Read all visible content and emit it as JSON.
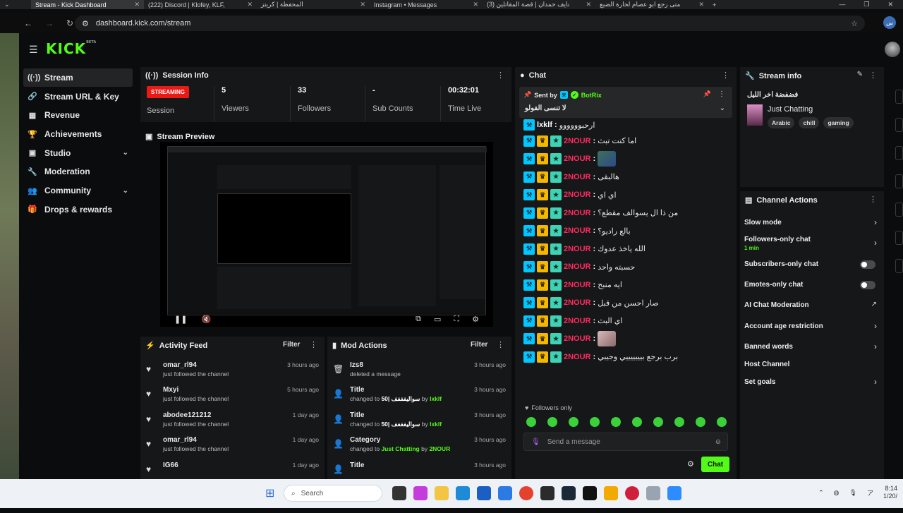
{
  "browser": {
    "tabs": [
      {
        "label": "Stream - Kick Dashboard",
        "active": true
      },
      {
        "label": "(222) Discord | Klofey, KLF,"
      },
      {
        "label": "المحفظة | كريتز"
      },
      {
        "label": "Instagram • Messages"
      },
      {
        "label": "(3) نايف حمدان | قصة المقاتلين"
      },
      {
        "label": "متى رجع ابو عصام لحارة الضبع"
      }
    ],
    "url": "dashboard.kick.com/stream",
    "profile_initial": "س"
  },
  "app": {
    "logo": "KICK",
    "logo_beta": "BETA"
  },
  "sidebar": {
    "items": [
      {
        "label": "Stream",
        "icon": "broadcast-icon",
        "glyph": "((·))",
        "active": true
      },
      {
        "label": "Stream URL & Key",
        "icon": "link-icon",
        "glyph": "🔗"
      },
      {
        "label": "Revenue",
        "icon": "revenue-icon",
        "glyph": "▦"
      },
      {
        "label": "Achievements",
        "icon": "trophy-icon",
        "glyph": "🏆"
      },
      {
        "label": "Studio",
        "icon": "studio-icon",
        "glyph": "▣",
        "expand": "⌄"
      },
      {
        "label": "Moderation",
        "icon": "wrench-icon",
        "glyph": "🔧"
      },
      {
        "label": "Community",
        "icon": "community-icon",
        "glyph": "👥",
        "expand": "⌄"
      },
      {
        "label": "Drops & rewards",
        "icon": "drops-icon",
        "glyph": "🎁"
      }
    ]
  },
  "session": {
    "title": "Session Info",
    "status": "STREAMING",
    "status_label": "Session",
    "stats": [
      {
        "value": "5",
        "label": "Viewers"
      },
      {
        "value": "33",
        "label": "Followers"
      },
      {
        "value": "-",
        "label": "Sub Counts"
      },
      {
        "value": "00:32:01",
        "label": "Time Live"
      }
    ]
  },
  "preview": {
    "title": "Stream Preview"
  },
  "activity": {
    "title": "Activity Feed",
    "filter": "Filter",
    "items": [
      {
        "name": "omar_rl94",
        "sub": "just followed the channel",
        "time": "3 hours ago"
      },
      {
        "name": "Mxyi",
        "sub": "just followed the channel",
        "time": "5 hours ago"
      },
      {
        "name": "abodee121212",
        "sub": "just followed the channel",
        "time": "1 day ago"
      },
      {
        "name": "omar_rl94",
        "sub": "just followed the channel",
        "time": "1 day ago"
      },
      {
        "name": "IG66",
        "sub": "",
        "time": "1 day ago"
      }
    ]
  },
  "mod_actions": {
    "title": "Mod Actions",
    "filter": "Filter",
    "items": [
      {
        "name": "Izs8",
        "pre": "deleted a message",
        "val": "",
        "by": "",
        "user": "",
        "time": "3 hours ago"
      },
      {
        "name": "Title",
        "pre": "changed to ",
        "val": "50| سواليفففف",
        "by": " by ",
        "user": "lxklf",
        "time": "3 hours ago"
      },
      {
        "name": "Title",
        "pre": "changed to ",
        "val": "50| سواليفففف",
        "by": " by ",
        "user": "lxklf",
        "time": "3 hours ago"
      },
      {
        "name": "Category",
        "pre": "changed to ",
        "val": "Just Chatting",
        "by": " by ",
        "user": "2NOUR",
        "time": "3 hours ago"
      },
      {
        "name": "Title",
        "pre": "",
        "val": "",
        "by": "",
        "user": "",
        "time": "3 hours ago"
      }
    ]
  },
  "chat": {
    "title": "Chat",
    "pinned_by_label": "Sent by",
    "pinned_user": "BotRix",
    "pinned_text": "لا تنسى الفولو",
    "first_user": "lxklf",
    "first_text": "ارحبوووووو",
    "user": "2NOUR",
    "messages": [
      "اما كنت تبث",
      "",
      "هالبقى",
      "اي اي",
      "من ذا ال يسوالف مقطع؟",
      "بالع راديو؟",
      "الله ياخذ عدوك",
      "حسبته واحد",
      "ايه منبح",
      "صار احسن من قبل",
      "اي البث",
      "",
      "برب برجع بيييييييي وجيبي"
    ],
    "followers_only": "Followers only",
    "placeholder": "Send a message",
    "send": "Chat"
  },
  "stream_info": {
    "title": "Stream info",
    "stream_title": "فضفضة اخر الليل",
    "category": "Just Chatting",
    "tags": [
      "Arabic",
      "chill",
      "gaming"
    ]
  },
  "channel_actions": {
    "title": "Channel Actions",
    "items": [
      {
        "label": "Slow mode",
        "control": "arrow"
      },
      {
        "label": "Followers-only chat",
        "sub": "1 min",
        "control": "arrow"
      },
      {
        "label": "Subscribers-only chat",
        "control": "toggle"
      },
      {
        "label": "Emotes-only chat",
        "control": "toggle"
      },
      {
        "label": "AI Chat Moderation",
        "control": "external"
      },
      {
        "label": "Account age restriction",
        "control": "arrow"
      },
      {
        "label": "Banned words",
        "control": "arrow"
      },
      {
        "label": "Host Channel",
        "control": "none"
      },
      {
        "label": "Set goals",
        "control": "arrow"
      }
    ]
  },
  "taskbar": {
    "search": "Search",
    "time": "8:14",
    "date": "1/20/"
  },
  "colors": {
    "accent": "#53fc18",
    "live": "#e91916",
    "username": "#ff2b5e"
  }
}
